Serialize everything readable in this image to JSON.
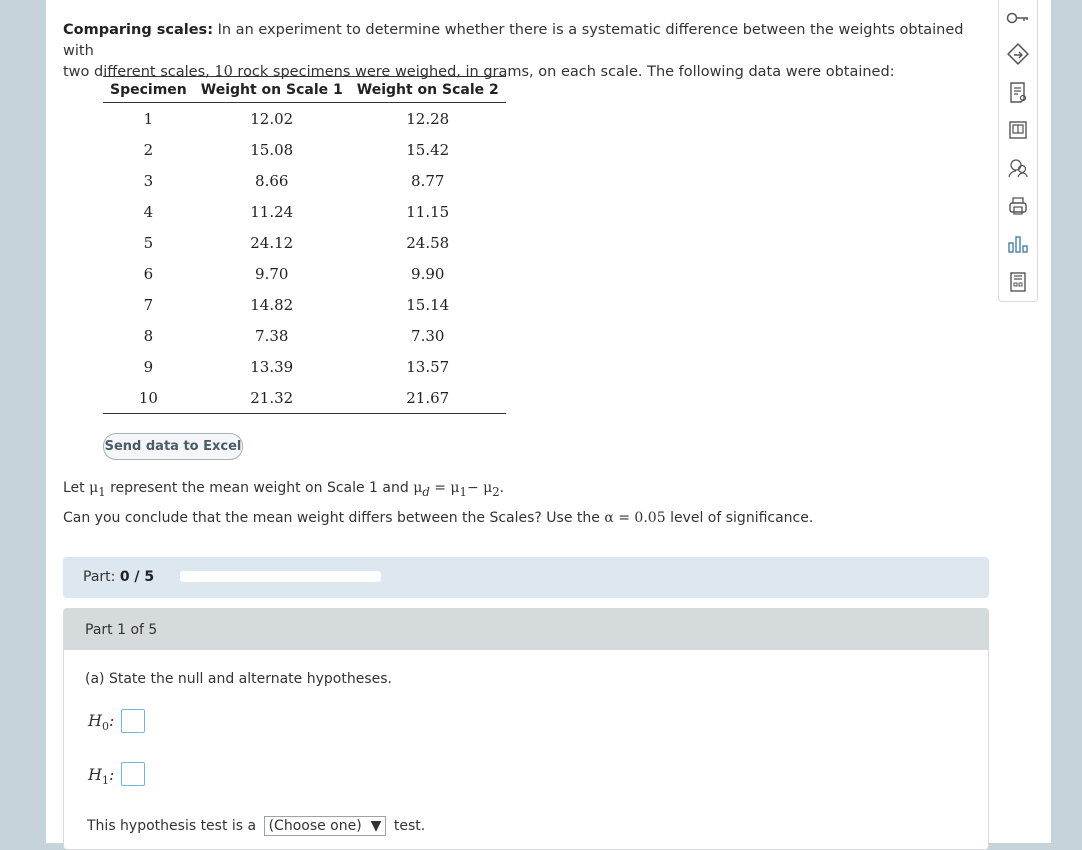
{
  "problem": {
    "title": "Comparing scales:",
    "text_line1": "In an experiment to determine whether there is a systematic difference between the weights obtained with",
    "text_line2_a": "two different scales,",
    "text_line2_num": "10",
    "text_line2_b": "rock specimens were weighed, in grams, on each scale. The following data were obtained:"
  },
  "table": {
    "headers": [
      "Specimen",
      "Weight on Scale 1",
      "Weight on Scale 2"
    ],
    "rows": [
      [
        "1",
        "12.02",
        "12.28"
      ],
      [
        "2",
        "15.08",
        "15.42"
      ],
      [
        "3",
        "8.66",
        "8.77"
      ],
      [
        "4",
        "11.24",
        "11.15"
      ],
      [
        "5",
        "24.12",
        "24.58"
      ],
      [
        "6",
        "9.70",
        "9.90"
      ],
      [
        "7",
        "14.82",
        "15.14"
      ],
      [
        "8",
        "7.38",
        "7.30"
      ],
      [
        "9",
        "13.39",
        "13.57"
      ],
      [
        "10",
        "21.32",
        "21.67"
      ]
    ]
  },
  "excel_button": "Send data to Excel",
  "definition": {
    "let": "Let",
    "mu1": "μ",
    "sub1": "1",
    "middle": "represent the mean weight on Scale 1 and",
    "mud": "μ",
    "subd": "d",
    "eq": "= μ",
    "eq_sub1": "1",
    "minus": "− μ",
    "eq_sub2": "2",
    "end": "."
  },
  "question": {
    "text_a": "Can you conclude that the mean weight differs between the Scales? Use the",
    "alpha": "α = 0.05",
    "text_b": "level of significance."
  },
  "progress": {
    "label": "Part:",
    "value": "0 / 5",
    "fraction": 0
  },
  "part": {
    "header": "Part 1 of 5",
    "prompt": "(a) State the null and alternate hypotheses.",
    "h0": "H",
    "h0_sub": "0",
    "h1": "H",
    "h1_sub": "1",
    "colon": ":",
    "test_a": "This hypothesis test is a",
    "select": "(Choose one)",
    "select_arrow": "▼",
    "test_b": "test."
  },
  "toolbar": {
    "icons": [
      "key-icon",
      "compass-icon",
      "notes-icon",
      "ebook-icon",
      "tutor-icon",
      "print-icon",
      "chart-icon",
      "calculator-icon"
    ]
  },
  "colors": {
    "page_bg": "#c6d3da",
    "progress_bar": "#dce7ef",
    "part_header": "#d5dadc",
    "answer_box_border": "#6fb6e0"
  }
}
